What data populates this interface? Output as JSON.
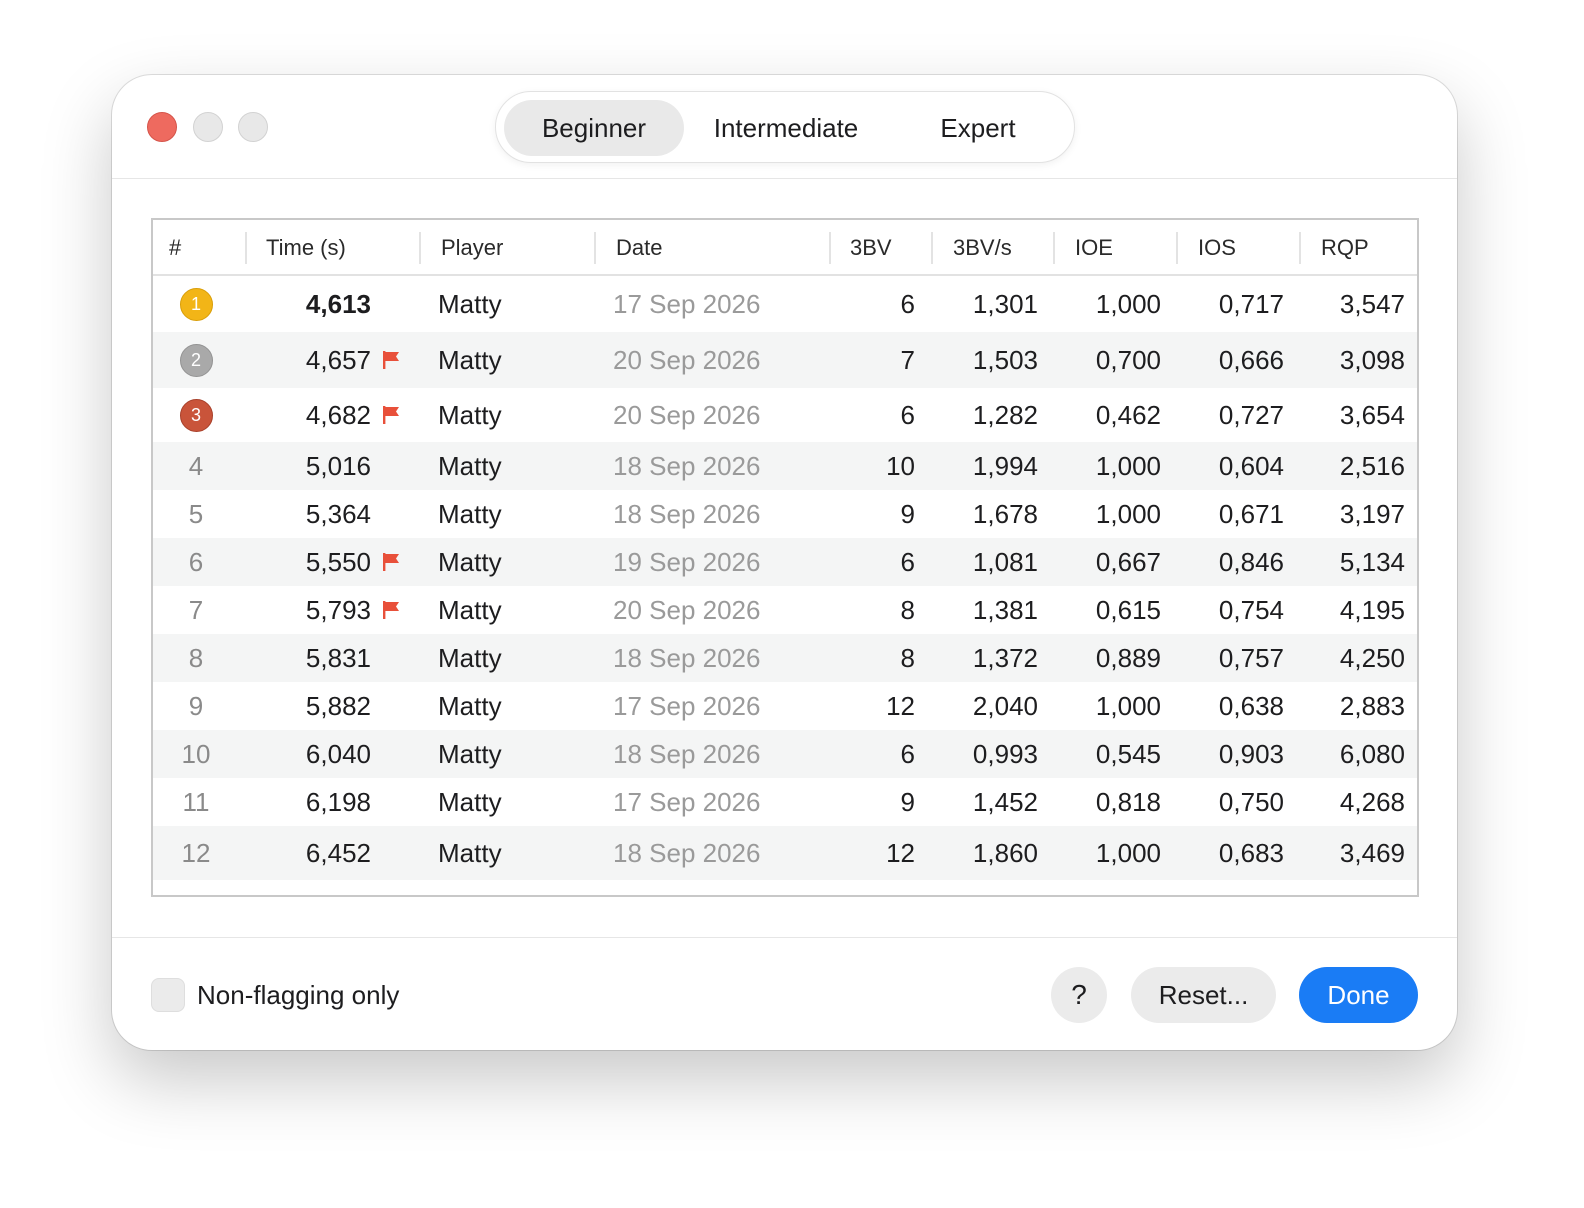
{
  "tabs": [
    {
      "label": "Beginner",
      "active": true
    },
    {
      "label": "Intermediate",
      "active": false
    },
    {
      "label": "Expert",
      "active": false
    }
  ],
  "table": {
    "headers": [
      "#",
      "Time (s)",
      "Player",
      "Date",
      "3BV",
      "3BV/s",
      "IOE",
      "IOS",
      "RQP"
    ],
    "rows": [
      {
        "rank": "1",
        "medal": "gold",
        "time": "4,613",
        "flag": false,
        "bold": true,
        "player": "Matty",
        "date": "17 Sep 2026",
        "bbv": "6",
        "bbvs": "1,301",
        "ioe": "1,000",
        "ios": "0,717",
        "rqp": "3,547"
      },
      {
        "rank": "2",
        "medal": "silver",
        "time": "4,657",
        "flag": true,
        "bold": false,
        "player": "Matty",
        "date": "20 Sep 2026",
        "bbv": "7",
        "bbvs": "1,503",
        "ioe": "0,700",
        "ios": "0,666",
        "rqp": "3,098"
      },
      {
        "rank": "3",
        "medal": "bronze",
        "time": "4,682",
        "flag": true,
        "bold": false,
        "player": "Matty",
        "date": "20 Sep 2026",
        "bbv": "6",
        "bbvs": "1,282",
        "ioe": "0,462",
        "ios": "0,727",
        "rqp": "3,654"
      },
      {
        "rank": "4",
        "medal": "",
        "time": "5,016",
        "flag": false,
        "bold": false,
        "player": "Matty",
        "date": "18 Sep 2026",
        "bbv": "10",
        "bbvs": "1,994",
        "ioe": "1,000",
        "ios": "0,604",
        "rqp": "2,516"
      },
      {
        "rank": "5",
        "medal": "",
        "time": "5,364",
        "flag": false,
        "bold": false,
        "player": "Matty",
        "date": "18 Sep 2026",
        "bbv": "9",
        "bbvs": "1,678",
        "ioe": "1,000",
        "ios": "0,671",
        "rqp": "3,197"
      },
      {
        "rank": "6",
        "medal": "",
        "time": "5,550",
        "flag": true,
        "bold": false,
        "player": "Matty",
        "date": "19 Sep 2026",
        "bbv": "6",
        "bbvs": "1,081",
        "ioe": "0,667",
        "ios": "0,846",
        "rqp": "5,134"
      },
      {
        "rank": "7",
        "medal": "",
        "time": "5,793",
        "flag": true,
        "bold": false,
        "player": "Matty",
        "date": "20 Sep 2026",
        "bbv": "8",
        "bbvs": "1,381",
        "ioe": "0,615",
        "ios": "0,754",
        "rqp": "4,195"
      },
      {
        "rank": "8",
        "medal": "",
        "time": "5,831",
        "flag": false,
        "bold": false,
        "player": "Matty",
        "date": "18 Sep 2026",
        "bbv": "8",
        "bbvs": "1,372",
        "ioe": "0,889",
        "ios": "0,757",
        "rqp": "4,250"
      },
      {
        "rank": "9",
        "medal": "",
        "time": "5,882",
        "flag": false,
        "bold": false,
        "player": "Matty",
        "date": "17 Sep 2026",
        "bbv": "12",
        "bbvs": "2,040",
        "ioe": "1,000",
        "ios": "0,638",
        "rqp": "2,883"
      },
      {
        "rank": "10",
        "medal": "",
        "time": "6,040",
        "flag": false,
        "bold": false,
        "player": "Matty",
        "date": "18 Sep 2026",
        "bbv": "6",
        "bbvs": "0,993",
        "ioe": "0,545",
        "ios": "0,903",
        "rqp": "6,080"
      },
      {
        "rank": "11",
        "medal": "",
        "time": "6,198",
        "flag": false,
        "bold": false,
        "player": "Matty",
        "date": "17 Sep 2026",
        "bbv": "9",
        "bbvs": "1,452",
        "ioe": "0,818",
        "ios": "0,750",
        "rqp": "4,268"
      },
      {
        "rank": "12",
        "medal": "",
        "time": "6,452",
        "flag": false,
        "bold": false,
        "player": "Matty",
        "date": "18 Sep 2026",
        "bbv": "12",
        "bbvs": "1,860",
        "ioe": "1,000",
        "ios": "0,683",
        "rqp": "3,469"
      }
    ]
  },
  "footer": {
    "checkbox_label": "Non-flagging only",
    "help_label": "?",
    "reset_label": "Reset...",
    "done_label": "Done"
  },
  "colors": {
    "accent": "#1a7cf5",
    "flag": "#e8503a",
    "close": "#ee6a5f",
    "gold": "#f2b517",
    "silver": "#a9a9a9",
    "bronze": "#c9543a"
  }
}
